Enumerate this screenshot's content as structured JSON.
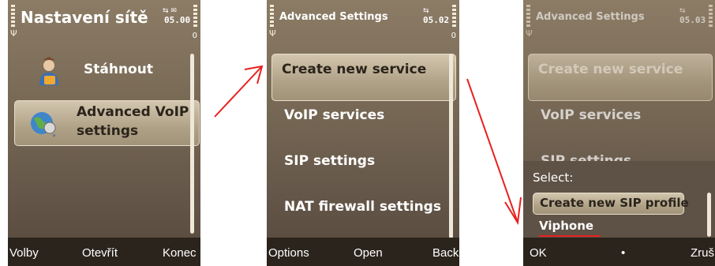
{
  "screen1": {
    "title": "Nastavení sítě",
    "time": "05.00",
    "indicators": "⇆ ✉",
    "battery_level": "0",
    "items": [
      {
        "label": "Stáhnout",
        "icon": "download-person-icon"
      },
      {
        "label_line1": "Advanced VoIP",
        "label_line2": "settings",
        "icon": "globe-phone-icon"
      }
    ],
    "softkeys": {
      "left": "Volby",
      "center": "Otevřít",
      "right": "Konec"
    }
  },
  "screen2": {
    "title": "Advanced Settings",
    "time": "05.02",
    "indicators": "⇆",
    "battery_level": "0",
    "items": [
      "Create new service",
      "VoIP services",
      "SIP settings",
      "NAT firewall settings"
    ],
    "softkeys": {
      "left": "Options",
      "center": "Open",
      "right": "Back"
    }
  },
  "screen3": {
    "title": "Advanced Settings",
    "time": "05.03",
    "indicators": "⇆",
    "items": [
      "Create new service",
      "VoIP services",
      "SIP settings"
    ],
    "popup": {
      "header": "Select:",
      "options": [
        "Create new SIP profile",
        "Viphone"
      ]
    },
    "softkeys": {
      "left": "OK",
      "center": "•",
      "right": "Zruš"
    }
  },
  "colors": {
    "arrow": "#e8201e",
    "highlight": "#bdb095",
    "softkey_bar": "#2b241c"
  }
}
